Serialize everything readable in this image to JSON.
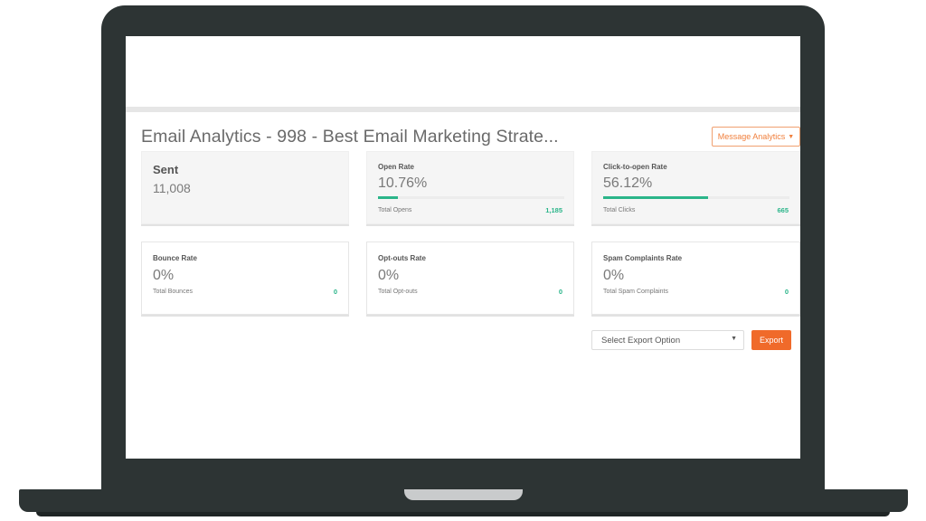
{
  "header": {
    "title": "Email Analytics - 998 - Best Email Marketing Strate...",
    "analytics_dropdown": "Message Analytics"
  },
  "cards": {
    "sent": {
      "label": "Sent",
      "value": "11,008"
    },
    "open_rate": {
      "label": "Open Rate",
      "value": "10.76%",
      "progress": 0.1076,
      "sub_label": "Total Opens",
      "count": "1,185"
    },
    "click_to_open": {
      "label": "Click-to-open Rate",
      "value": "56.12%",
      "progress": 0.5612,
      "sub_label": "Total Clicks",
      "count": "665"
    },
    "bounce": {
      "label": "Bounce Rate",
      "value": "0%",
      "sub_label": "Total Bounces",
      "count": "0"
    },
    "optouts": {
      "label": "Opt-outs Rate",
      "value": "0%",
      "sub_label": "Total Opt-outs",
      "count": "0"
    },
    "spam": {
      "label": "Spam Complaints Rate",
      "value": "0%",
      "sub_label": "Total Spam Complaints",
      "count": "0"
    }
  },
  "export": {
    "select_value": "Select Export Option",
    "button_label": "Export"
  },
  "colors": {
    "accent_orange": "#f06a2a",
    "accent_green": "#2bb58a",
    "frame": "#2d3434"
  }
}
